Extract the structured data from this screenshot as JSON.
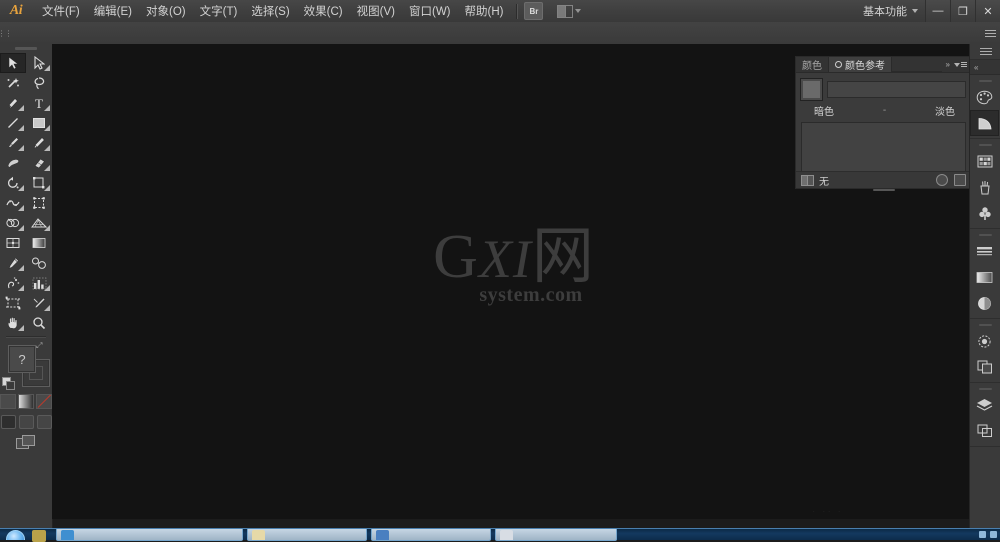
{
  "app": {
    "name": "Adobe Illustrator",
    "logo_text": "Ai",
    "workspace": "基本功能",
    "bridge_button": "Br"
  },
  "menubar": {
    "items": [
      {
        "label": "文件(F)",
        "name": "menu-file"
      },
      {
        "label": "编辑(E)",
        "name": "menu-edit"
      },
      {
        "label": "对象(O)",
        "name": "menu-object"
      },
      {
        "label": "文字(T)",
        "name": "menu-type"
      },
      {
        "label": "选择(S)",
        "name": "menu-select"
      },
      {
        "label": "效果(C)",
        "name": "menu-effect"
      },
      {
        "label": "视图(V)",
        "name": "menu-view"
      },
      {
        "label": "窗口(W)",
        "name": "menu-window"
      },
      {
        "label": "帮助(H)",
        "name": "menu-help"
      }
    ]
  },
  "window_controls": {
    "minimize": "—",
    "maximize": "❐",
    "close": "✕"
  },
  "toolbar": {
    "tools": [
      {
        "label": "选择工具",
        "icon": "selection-arrow-icon",
        "selected": true,
        "submenu": false
      },
      {
        "label": "直接选择工具",
        "icon": "direct-selection-arrow-icon",
        "selected": false,
        "submenu": true
      },
      {
        "label": "魔棒工具",
        "icon": "magic-wand-icon",
        "selected": false,
        "submenu": false
      },
      {
        "label": "套索工具",
        "icon": "lasso-icon",
        "selected": false,
        "submenu": false
      },
      {
        "label": "钢笔工具",
        "icon": "pen-icon",
        "selected": false,
        "submenu": true
      },
      {
        "label": "文字工具",
        "icon": "type-t-icon",
        "selected": false,
        "submenu": true
      },
      {
        "label": "直线段工具",
        "icon": "line-segment-icon",
        "selected": false,
        "submenu": true
      },
      {
        "label": "矩形工具",
        "icon": "rectangle-icon",
        "selected": false,
        "submenu": true
      },
      {
        "label": "画笔工具",
        "icon": "paintbrush-icon",
        "selected": false,
        "submenu": true
      },
      {
        "label": "铅笔工具",
        "icon": "pencil-icon",
        "selected": false,
        "submenu": true
      },
      {
        "label": "斑点画笔工具",
        "icon": "blob-brush-icon",
        "selected": false,
        "submenu": false
      },
      {
        "label": "橡皮擦工具",
        "icon": "eraser-icon",
        "selected": false,
        "submenu": true
      },
      {
        "label": "旋转工具",
        "icon": "rotate-icon",
        "selected": false,
        "submenu": true
      },
      {
        "label": "比例缩放工具",
        "icon": "scale-icon",
        "selected": false,
        "submenu": true
      },
      {
        "label": "变形工具",
        "icon": "warp-icon",
        "selected": false,
        "submenu": true
      },
      {
        "label": "自由变换工具",
        "icon": "free-transform-icon",
        "selected": false,
        "submenu": false
      },
      {
        "label": "形状生成器工具",
        "icon": "shape-builder-icon",
        "selected": false,
        "submenu": true
      },
      {
        "label": "透视网格工具",
        "icon": "perspective-grid-icon",
        "selected": false,
        "submenu": true
      },
      {
        "label": "网格工具",
        "icon": "mesh-icon",
        "selected": false,
        "submenu": false
      },
      {
        "label": "渐变工具",
        "icon": "gradient-icon",
        "selected": false,
        "submenu": false
      },
      {
        "label": "吸管工具",
        "icon": "eyedropper-icon",
        "selected": false,
        "submenu": true
      },
      {
        "label": "混合工具",
        "icon": "blend-icon",
        "selected": false,
        "submenu": false
      },
      {
        "label": "符号喷枪工具",
        "icon": "symbol-sprayer-icon",
        "selected": false,
        "submenu": true
      },
      {
        "label": "柱形图工具",
        "icon": "column-graph-icon",
        "selected": false,
        "submenu": true
      },
      {
        "label": "画板工具",
        "icon": "artboard-icon",
        "selected": false,
        "submenu": false
      },
      {
        "label": "切片工具",
        "icon": "slice-knife-icon",
        "selected": false,
        "submenu": true
      },
      {
        "label": "抓手工具",
        "icon": "hand-icon",
        "selected": false,
        "submenu": true
      },
      {
        "label": "缩放工具",
        "icon": "zoom-magnifier-icon",
        "selected": false,
        "submenu": false
      }
    ],
    "fill_stroke": {
      "fill_glyph": "?",
      "swap_glyph": "⤢",
      "fill_label": "填色",
      "stroke_label": "描边"
    },
    "color_modes": [
      {
        "label": "颜色",
        "name": "color-mode-color"
      },
      {
        "label": "渐变",
        "name": "color-mode-gradient"
      },
      {
        "label": "无",
        "name": "color-mode-none"
      }
    ],
    "draw_modes": [
      {
        "label": "正常绘图",
        "name": "draw-mode-normal"
      },
      {
        "label": "背面绘图",
        "name": "draw-mode-behind"
      },
      {
        "label": "内部绘图",
        "name": "draw-mode-inside"
      }
    ],
    "screen_mode_label": "更改屏幕模式"
  },
  "canvas": {
    "watermark_main": "G",
    "watermark_italic": "XI",
    "watermark_cjk": "网",
    "watermark_sub": "system.com",
    "faint_text": "· ·· ·"
  },
  "color_guide_panel": {
    "tabs": [
      {
        "label": "颜色",
        "active": false,
        "name": "tab-color"
      },
      {
        "label": "颜色参考",
        "active": true,
        "name": "tab-color-guide"
      }
    ],
    "collapse_glyph": "»",
    "shades_label": "暗色",
    "separator": "-",
    "tints_label": "淡色",
    "footer_label": "无",
    "harmony_placeholder": ""
  },
  "dock": {
    "groups": [
      {
        "items": [
          {
            "label": "颜色",
            "icon": "palette-icon",
            "selected": false
          },
          {
            "label": "颜色参考",
            "icon": "color-guide-wedge-icon",
            "selected": true
          }
        ]
      },
      {
        "items": [
          {
            "label": "色板",
            "icon": "swatches-grid-icon",
            "selected": false
          },
          {
            "label": "画笔",
            "icon": "brushes-cup-icon",
            "selected": false
          },
          {
            "label": "符号",
            "icon": "symbols-clover-icon",
            "selected": false
          }
        ]
      },
      {
        "items": [
          {
            "label": "描边",
            "icon": "stroke-lines-icon",
            "selected": false
          },
          {
            "label": "渐变",
            "icon": "gradient-bar-icon",
            "selected": false
          },
          {
            "label": "透明度",
            "icon": "transparency-circle-icon",
            "selected": false
          }
        ]
      },
      {
        "items": [
          {
            "label": "外观",
            "icon": "appearance-circle-icon",
            "selected": false
          },
          {
            "label": "图形样式",
            "icon": "graphic-styles-icon",
            "selected": false
          }
        ]
      },
      {
        "items": [
          {
            "label": "图层",
            "icon": "layers-stack-icon",
            "selected": false
          },
          {
            "label": "画板",
            "icon": "artboards-panel-icon",
            "selected": false
          }
        ]
      }
    ]
  },
  "taskbar": {
    "start_label": "开始",
    "items": [
      {
        "name": "taskbar-item-1",
        "color": "#cfd9e4"
      },
      {
        "name": "taskbar-item-2",
        "color": "#e8dcb8"
      },
      {
        "name": "taskbar-item-3",
        "color": "#cfd9e4"
      },
      {
        "name": "taskbar-item-4",
        "color": "#dfe6ee"
      }
    ]
  }
}
